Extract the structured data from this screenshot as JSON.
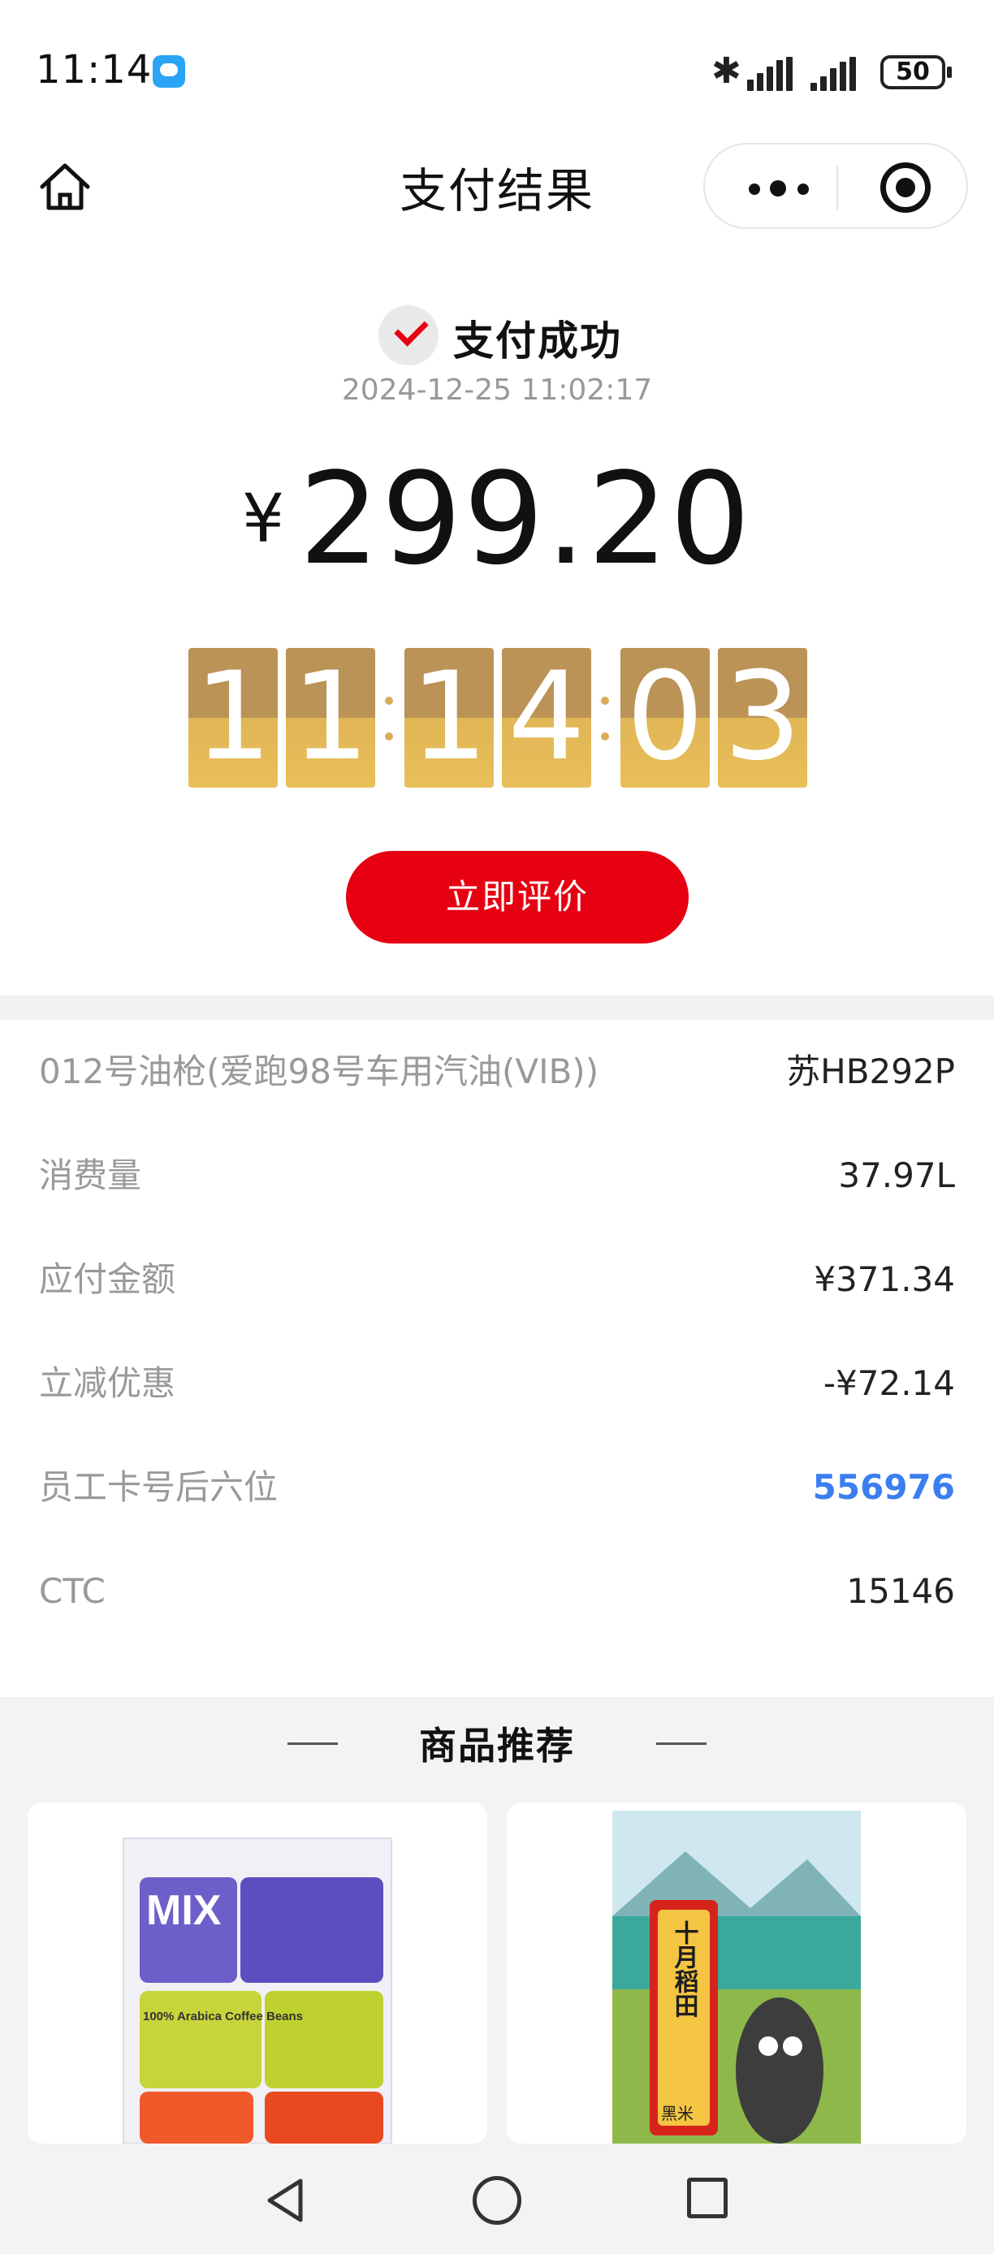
{
  "status_bar": {
    "time": "11:14",
    "battery": "50"
  },
  "nav": {
    "title": "支付结果"
  },
  "result": {
    "status": "支付成功",
    "datetime": "2024-12-25 11:02:17",
    "currency": "¥",
    "amount": "299.20"
  },
  "clock": {
    "digits": [
      "1",
      "1",
      "1",
      "4",
      "0",
      "3"
    ]
  },
  "review_button": "立即评价",
  "details": [
    {
      "label": "012号油枪(爱跑98号车用汽油(VIB))",
      "value": "苏HB292P"
    },
    {
      "label": "消费量",
      "value": "37.97L"
    },
    {
      "label": "应付金额",
      "value": "¥371.34"
    },
    {
      "label": "立减优惠",
      "value": "-¥72.14"
    },
    {
      "label": "员工卡号后六位",
      "value": "556976"
    },
    {
      "label": "CTC",
      "value": "15146"
    }
  ],
  "recommend": {
    "title": "商品推荐",
    "products": [
      {
        "image_text": "MIX",
        "sub_text": "100% Arabica Coffee Beans"
      },
      {
        "image_text": "十月稻田",
        "sub_text": "黑米"
      }
    ]
  },
  "colors": {
    "accent": "#e60012",
    "gold_top": "#bb9356",
    "gold_bottom": "#e0b656",
    "link_blue": "#3a7ef0"
  }
}
